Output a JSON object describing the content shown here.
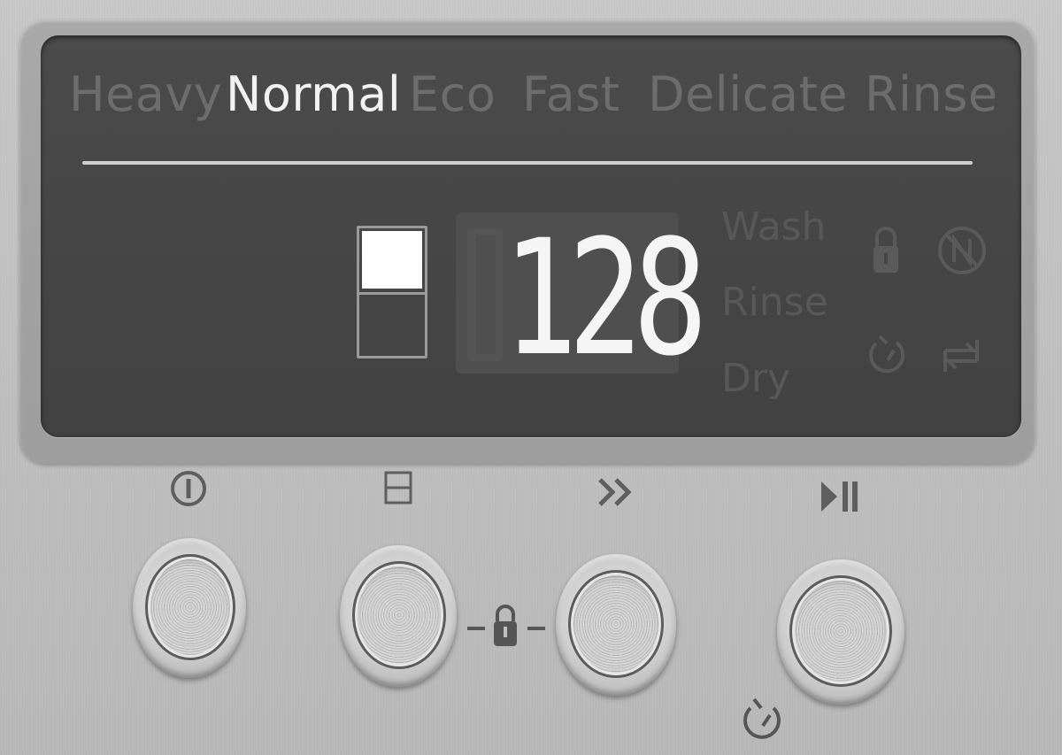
{
  "programs": [
    {
      "label": "Heavy",
      "active": false
    },
    {
      "label": "Normal",
      "active": true
    },
    {
      "label": "Eco",
      "active": false
    },
    {
      "label": "Fast",
      "active": false
    },
    {
      "label": "Delicate",
      "active": false
    },
    {
      "label": "Rinse",
      "active": false
    }
  ],
  "display": {
    "time_value": "128",
    "phases": {
      "wash": "Wash",
      "rinse": "Rinse",
      "dry": "Dry"
    },
    "icons": [
      "child-lock-icon",
      "no-water-icon",
      "delay-timer-icon",
      "rinse-aid-icon"
    ]
  },
  "buttons": [
    {
      "name": "power",
      "icon": "power-icon"
    },
    {
      "name": "half-load",
      "icon": "half-load-icon"
    },
    {
      "name": "program",
      "icon": "fast-forward-icon"
    },
    {
      "name": "start-pause",
      "icon": "play-pause-icon"
    }
  ],
  "extra_icons": [
    "lock-combo-icon",
    "delay-timer-icon"
  ],
  "colors": {
    "active_text": "#f2f2f2",
    "inactive_text": "#6d6d6d",
    "display_bg": "#454545"
  }
}
